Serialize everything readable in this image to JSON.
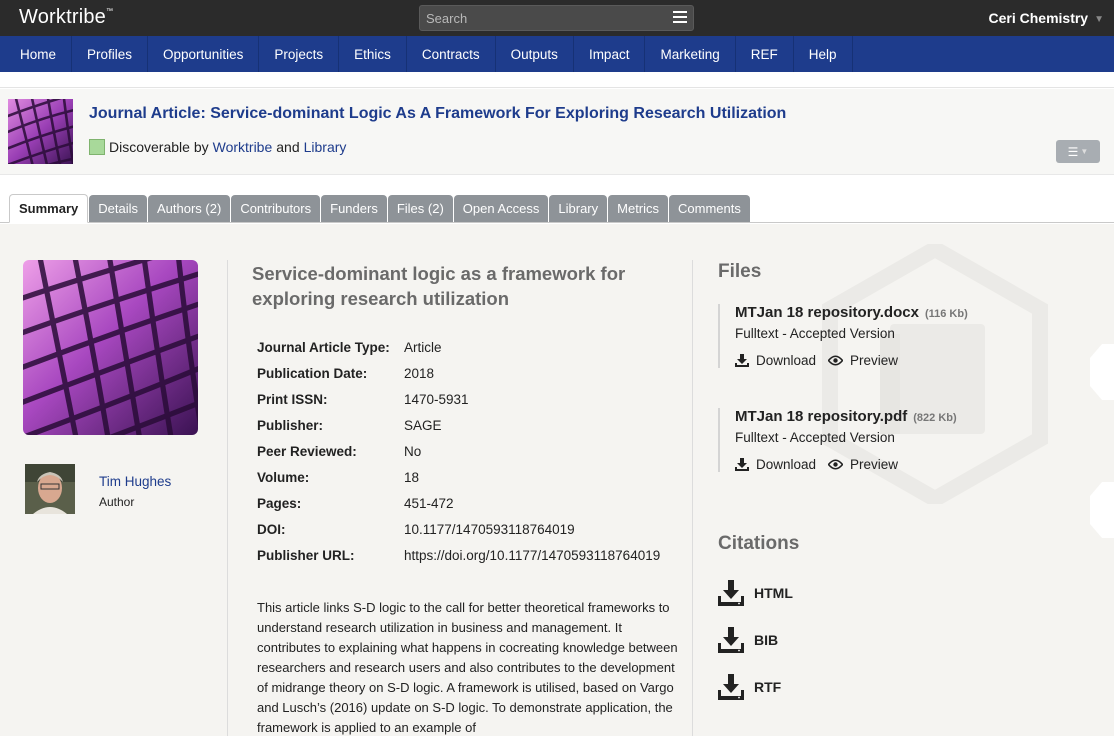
{
  "topbar": {
    "logo": "Worktribe",
    "logo_tm": "™",
    "search_placeholder": "Search",
    "user": "Ceri Chemistry"
  },
  "nav": [
    "Home",
    "Profiles",
    "Opportunities",
    "Projects",
    "Ethics",
    "Contracts",
    "Outputs",
    "Impact",
    "Marketing",
    "REF",
    "Help"
  ],
  "header": {
    "title": "Journal Article: Service-dominant Logic As A Framework For Exploring Research Utilization",
    "discoverable_prefix": "Discoverable by",
    "discoverable_link1": "Worktribe",
    "discoverable_and": "and",
    "discoverable_link2": "Library"
  },
  "tabs": [
    "Summary",
    "Details",
    "Authors (2)",
    "Contributors",
    "Funders",
    "Files (2)",
    "Open Access",
    "Library",
    "Metrics",
    "Comments"
  ],
  "active_tab": "Summary",
  "author": {
    "name": "Tim Hughes",
    "role": "Author"
  },
  "article": {
    "title": "Service-dominant logic as a framework for exploring research utilization",
    "meta": [
      {
        "key": "Journal Article Type:",
        "value": "Article"
      },
      {
        "key": "Publication Date:",
        "value": "2018"
      },
      {
        "key": "Print ISSN:",
        "value": "1470-5931"
      },
      {
        "key": "Publisher:",
        "value": "SAGE"
      },
      {
        "key": "Peer Reviewed:",
        "value": "No"
      },
      {
        "key": "Volume:",
        "value": "18"
      },
      {
        "key": "Pages:",
        "value": "451-472"
      },
      {
        "key": "DOI:",
        "value": "10.1177/1470593118764019"
      },
      {
        "key": "Publisher URL:",
        "value": "https://doi.org/10.1177/1470593118764019"
      }
    ],
    "abstract": "This article links S-D logic to the call for better theoretical frameworks to understand research utilization in business and management. It contributes to explaining what happens in cocreating knowledge between researchers and research users and also contributes to the development of midrange theory on S-D logic. A framework is utilised, based on Vargo and Lusch’s (2016) update on S-D logic. To demonstrate application, the framework is applied to an example of"
  },
  "files": {
    "heading": "Files",
    "items": [
      {
        "name": "MTJan 18 repository.docx",
        "size": "(116 Kb)",
        "version": "Fulltext - Accepted Version",
        "download": "Download",
        "preview": "Preview"
      },
      {
        "name": "MTJan 18 repository.pdf",
        "size": "(822 Kb)",
        "version": "Fulltext - Accepted Version",
        "download": "Download",
        "preview": "Preview"
      }
    ]
  },
  "citations": {
    "heading": "Citations",
    "items": [
      "HTML",
      "BIB",
      "RTF"
    ]
  },
  "colors": {
    "topbar": "#2b2b2b",
    "navbar": "#1e3c8c",
    "link": "#1e3c8c",
    "tab_inactive": "#8e9398",
    "swatch": "#a8d99a"
  }
}
